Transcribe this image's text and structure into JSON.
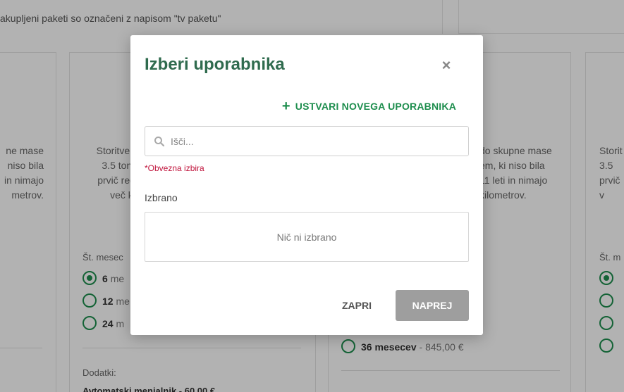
{
  "background": {
    "top_note": "akupljeni paketi so označeni z napisom \"tv paketu\"",
    "cards": [
      {
        "text_lines": [
          "ne mase",
          "niso bila",
          "in nimajo",
          "metrov."
        ]
      },
      {
        "text_lines": [
          "Storitve s",
          "3.5 tone",
          "prvič regi",
          "več kil"
        ]
      },
      {
        "text_lines": [
          "do skupne mase",
          "em, ki niso bila",
          "11 leti in nimajo",
          "kilometrov."
        ]
      },
      {
        "text_lines": [
          "Storit",
          "3.5",
          "prvič",
          "v"
        ]
      }
    ],
    "months_label": "Št. mesec",
    "months_label_right": "Št. m",
    "radios": [
      {
        "value": "6",
        "unit": "me",
        "selected": true
      },
      {
        "value": "12",
        "unit": "me",
        "selected": false
      },
      {
        "value": "24",
        "unit": "m",
        "selected": false
      }
    ],
    "radio_36": {
      "value": "36",
      "unit": "mesecev",
      "price": "- 845,00 €"
    },
    "dodatki_label": "Dodatki:",
    "dodatki_item": "Avtomatski menjalnik - 60,00 €"
  },
  "modal": {
    "title": "Izberi uporabnika",
    "close_icon": "×",
    "create_user_label": "USTVARI NOVEGA UPORABNIKA",
    "search_placeholder": "Išči...",
    "required_text": "*Obvezna izbira",
    "selected_label": "Izbrano",
    "selected_empty": "Nič ni izbrano",
    "close_button": "ZAPRI",
    "next_button": "NAPREJ"
  },
  "colors": {
    "brand_green": "#1e8e4e",
    "title_green": "#2f6b4e",
    "required_red": "#c0143c",
    "disabled_button": "#9e9e9e"
  },
  "icons": [
    "close-icon",
    "plus-icon",
    "search-icon"
  ]
}
